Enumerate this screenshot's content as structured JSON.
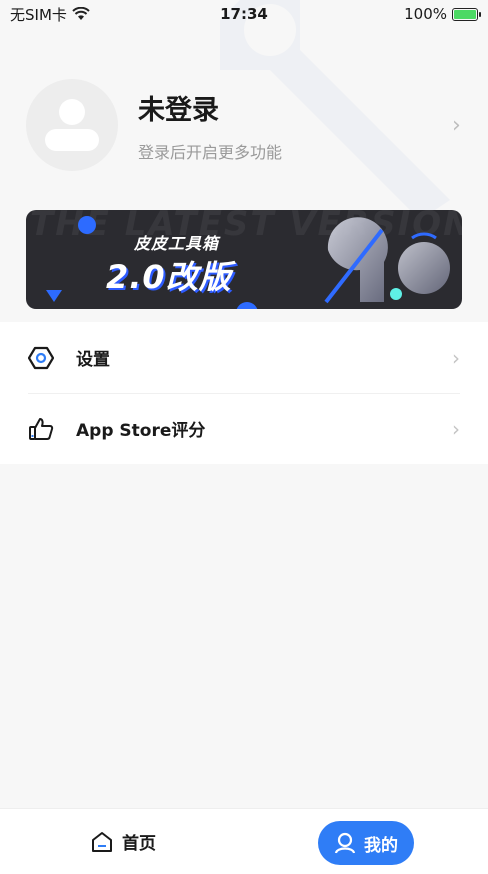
{
  "status_bar": {
    "carrier": "无SIM卡",
    "time": "17:34",
    "battery": "100%"
  },
  "profile": {
    "name": "未登录",
    "subtitle": "登录后开启更多功能"
  },
  "banner": {
    "small_title": "皮皮工具箱",
    "big_title": "2.0改版",
    "background_text": "THE LATEST VERSION TOOL LATEST"
  },
  "menu": {
    "items": [
      {
        "label": "设置",
        "icon": "settings-hexagon-icon"
      },
      {
        "label": "App Store评分",
        "icon": "thumbs-up-icon"
      }
    ]
  },
  "tab_bar": {
    "home_label": "首页",
    "mine_label": "我的"
  },
  "colors": {
    "accent": "#2f7df6",
    "banner_bg": "#2b2b30",
    "page_bg": "#f7f7f7"
  }
}
